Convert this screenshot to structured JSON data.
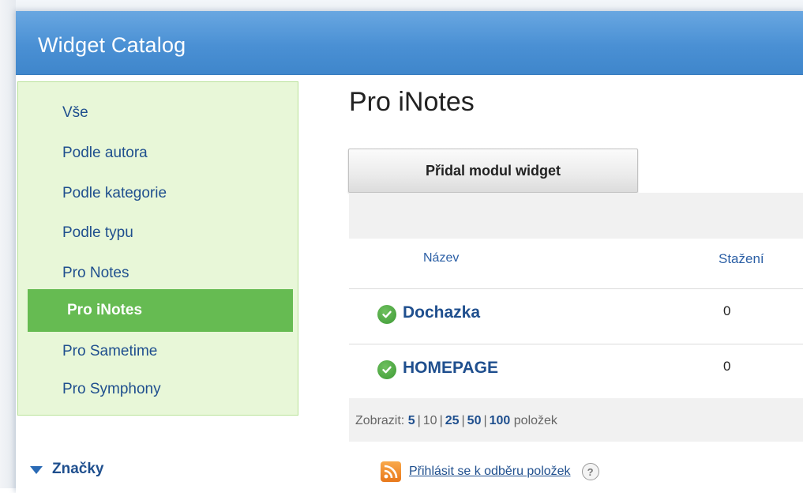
{
  "app": {
    "title": "Widget Catalog"
  },
  "sidebar": {
    "items": [
      {
        "label": "Vše"
      },
      {
        "label": "Podle autora"
      },
      {
        "label": "Podle kategorie"
      },
      {
        "label": "Podle typu"
      },
      {
        "label": "Pro Notes"
      },
      {
        "label": "Pro iNotes",
        "active": true
      },
      {
        "label": "Pro Sametime"
      },
      {
        "label": "Pro Symphony"
      }
    ],
    "tags_header": "Značky"
  },
  "main": {
    "page_title": "Pro iNotes",
    "add_button_label": "Přidal modul widget",
    "table": {
      "columns": [
        "Název",
        "Stažení"
      ],
      "rows": [
        {
          "name": "Dochazka",
          "downloads": "0",
          "status_icon": "green-check-icon"
        },
        {
          "name": "HOMEPAGE",
          "downloads": "0",
          "status_icon": "green-check-icon"
        }
      ]
    },
    "pager": {
      "prefix": "Zobrazit:",
      "options": [
        "5",
        "10",
        "25",
        "50",
        "100"
      ],
      "selected": "10",
      "suffix": "položek"
    },
    "feed": {
      "link_label": "Přihlásit se k odběru položek",
      "help_label": "?"
    }
  },
  "colors": {
    "titlebar": "#4a90d4",
    "sidebar_bg": "#e8f7d8",
    "sidebar_active": "#66bb52",
    "link": "#1f4f8e"
  }
}
